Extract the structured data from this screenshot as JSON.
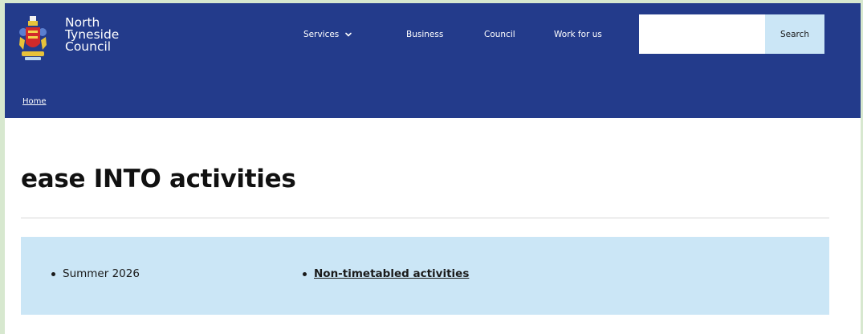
{
  "header": {
    "logo": {
      "icon": "crest-icon",
      "lines": [
        "North",
        "Tyneside",
        "Council"
      ]
    },
    "nav": {
      "services": "Services",
      "business": "Business",
      "council": "Council",
      "work_for_us": "Work for us"
    },
    "search": {
      "value": "",
      "button_label": "Search"
    },
    "breadcrumb": {
      "home": "Home"
    },
    "colors": {
      "header_bg": "#233b8b",
      "panel_bg": "#cbe6f6",
      "frame": "#d7e8cf"
    }
  },
  "main": {
    "title": "ease INTO activities",
    "panel": {
      "items": [
        {
          "label": "Summer 2026",
          "link": false
        },
        {
          "label": "Non-timetabled activities",
          "link": true
        }
      ]
    }
  }
}
